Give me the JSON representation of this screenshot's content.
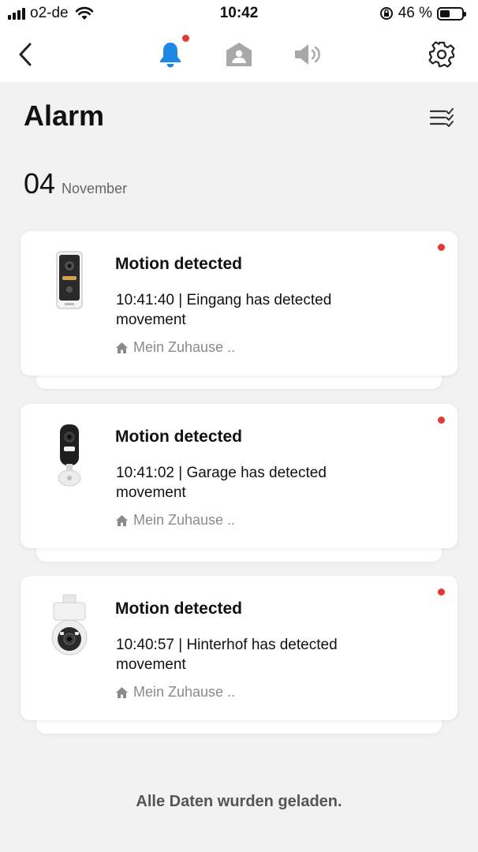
{
  "status_bar": {
    "carrier": "o2-de",
    "time": "10:42",
    "battery": "46 %",
    "battery_level": 0.46
  },
  "nav": {
    "icons": [
      "back-chevron-icon",
      "bell-icon",
      "home-user-icon",
      "speaker-icon",
      "gear-icon"
    ],
    "accent_color": "#1e88e5",
    "notification_dot_color": "#e53935"
  },
  "page": {
    "title": "Alarm"
  },
  "date_group": {
    "day": "04",
    "month": "November"
  },
  "alarms": [
    {
      "title": "Motion detected",
      "description": "10:41:40 | Eingang has detected movement",
      "location": "Mein Zuhause ..",
      "device": "doorbell-camera-icon",
      "unread": true
    },
    {
      "title": "Motion detected",
      "description": "10:41:02 | Garage has detected movement",
      "location": "Mein Zuhause ..",
      "device": "bullet-camera-icon",
      "unread": true
    },
    {
      "title": "Motion detected",
      "description": "10:40:57 | Hinterhof has detected movement",
      "location": "Mein Zuhause ..",
      "device": "pan-tilt-camera-icon",
      "unread": true
    }
  ],
  "footer": {
    "text": "Alle Daten wurden geladen."
  }
}
